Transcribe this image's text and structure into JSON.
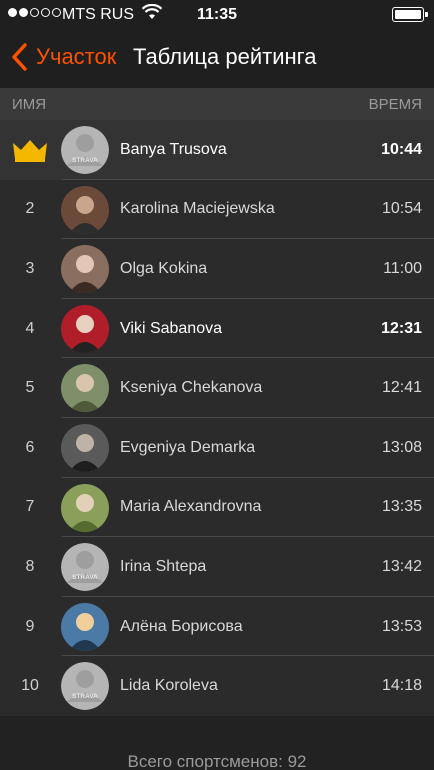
{
  "status_bar": {
    "signal_dots_filled": 2,
    "signal_dots_total": 5,
    "carrier": "MTS RUS",
    "time": "11:35",
    "battery_level": 1.0
  },
  "nav": {
    "back_label": "Участок",
    "title": "Таблица рейтинга",
    "accent_color": "#fc5200"
  },
  "table_header": {
    "name": "ИМЯ",
    "time": "ВРЕМЯ"
  },
  "leaderboard": [
    {
      "rank": "",
      "crown": true,
      "name": "Banya Trusova",
      "time": "10:44",
      "avatar": "strava-placeholder",
      "bold": true
    },
    {
      "rank": "2",
      "name": "Karolina Maciejewska",
      "time": "10:54",
      "avatar": "photo"
    },
    {
      "rank": "3",
      "name": "Olga Kokina",
      "time": "11:00",
      "avatar": "photo"
    },
    {
      "rank": "4",
      "name": "Viki Sabanova",
      "time": "12:31",
      "avatar": "photo",
      "bold": true
    },
    {
      "rank": "5",
      "name": "Kseniya Chekanova",
      "time": "12:41",
      "avatar": "photo"
    },
    {
      "rank": "6",
      "name": "Evgeniya Demarka",
      "time": "13:08",
      "avatar": "photo"
    },
    {
      "rank": "7",
      "name": "Maria Alexandrovna",
      "time": "13:35",
      "avatar": "photo"
    },
    {
      "rank": "8",
      "name": "Irina Shtepa",
      "time": "13:42",
      "avatar": "strava-placeholder"
    },
    {
      "rank": "9",
      "name": "Алёна Борисова",
      "time": "13:53",
      "avatar": "photo"
    },
    {
      "rank": "10",
      "name": "Lida Koroleva",
      "time": "14:18",
      "avatar": "strava-placeholder"
    }
  ],
  "placeholder_text": "STRAVA",
  "footer": {
    "total": "Всего спортсменов: 92"
  }
}
